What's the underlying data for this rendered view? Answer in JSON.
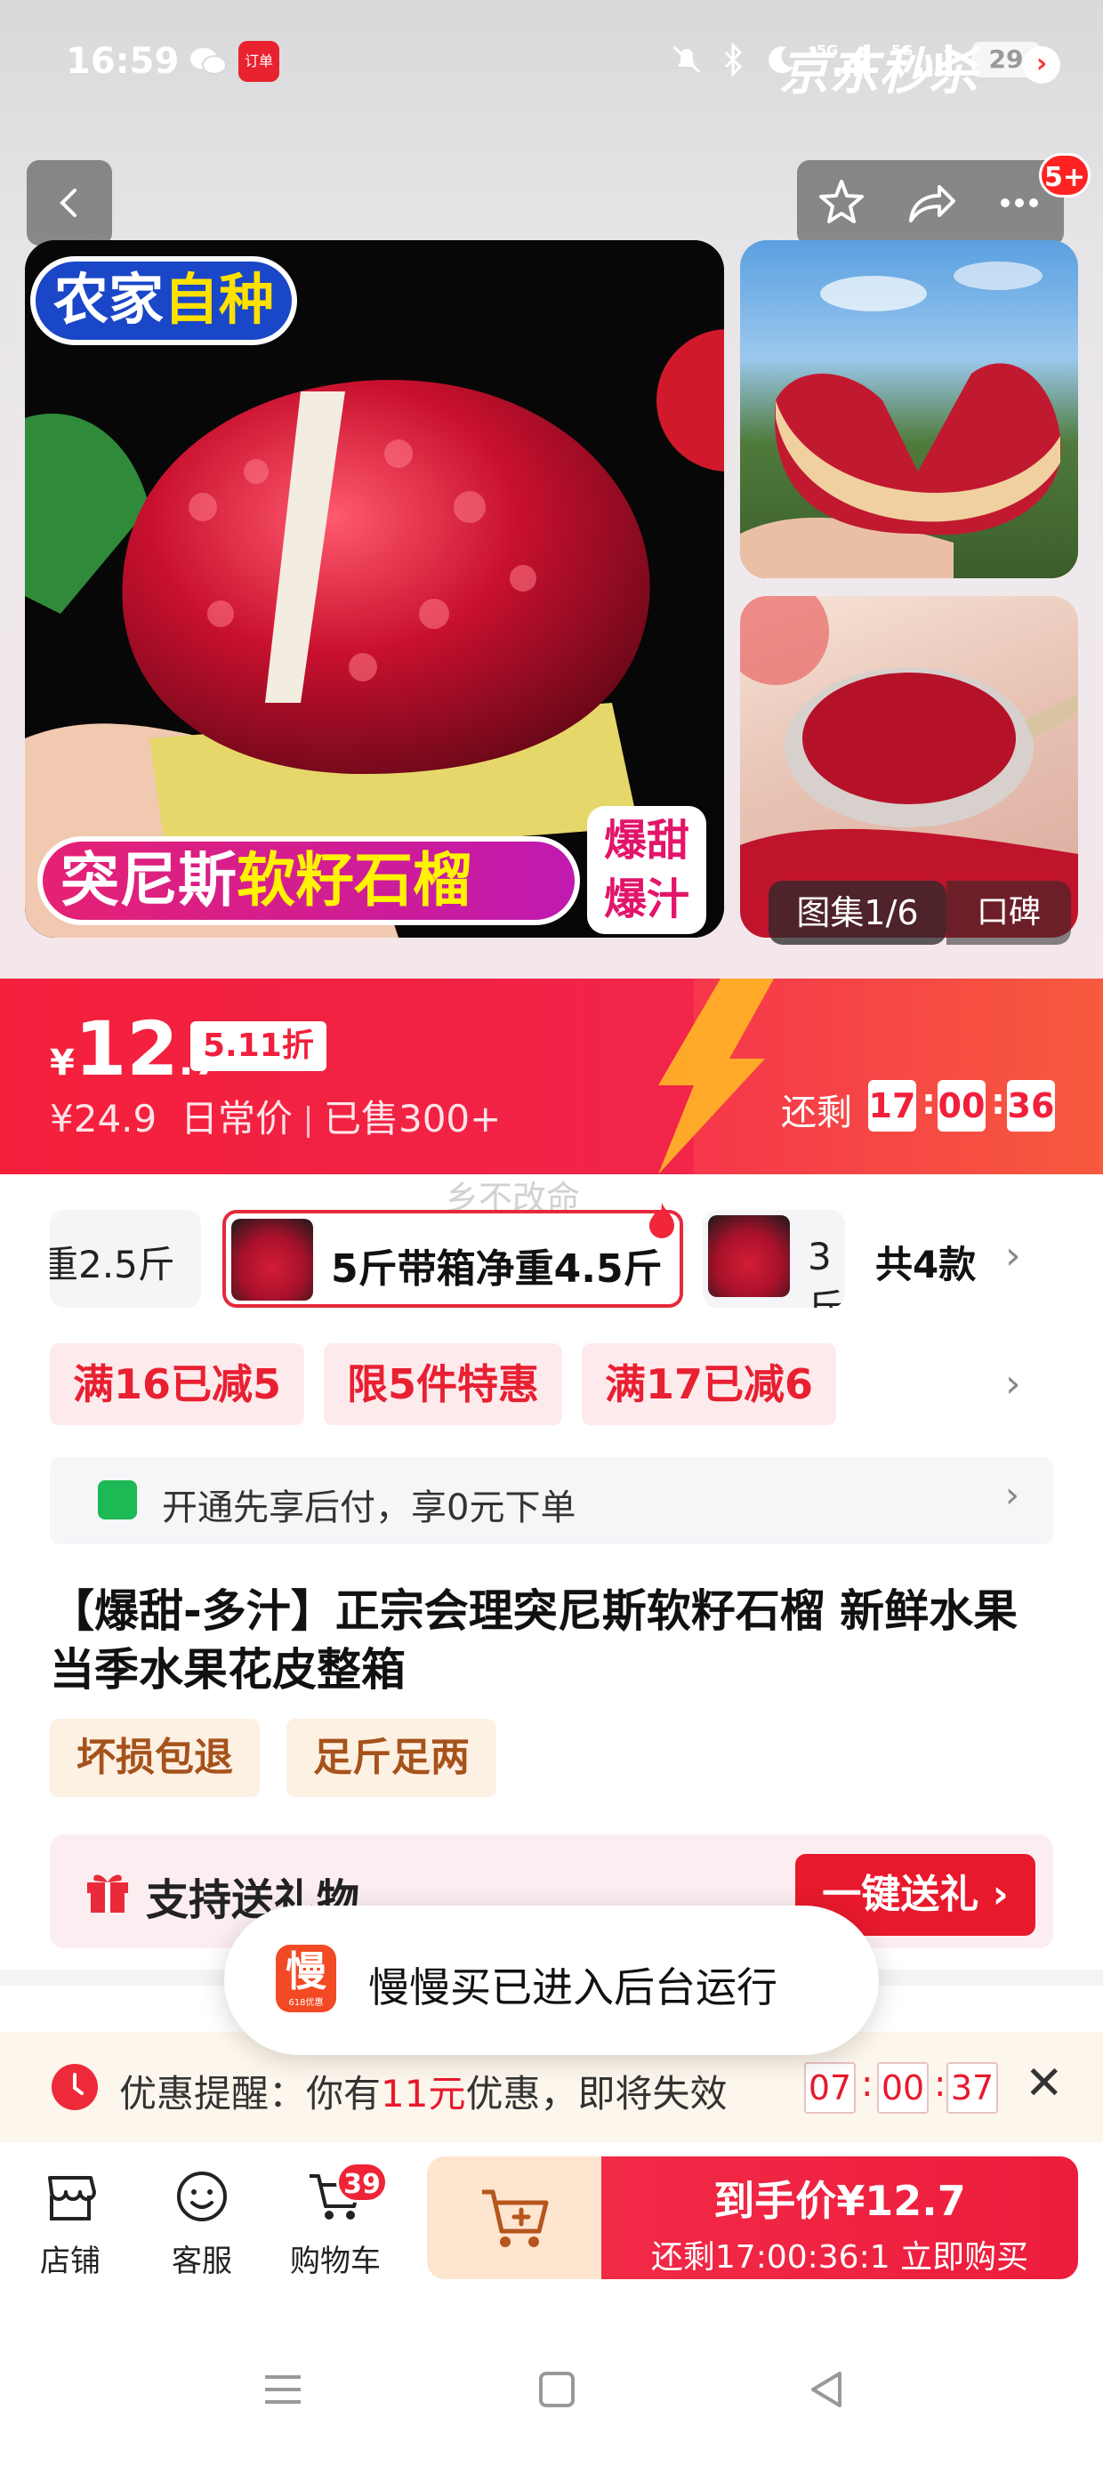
{
  "status_bar": {
    "time": "16:59",
    "app_badge": "订单",
    "network1": "5G",
    "network2": "5G",
    "battery": "29"
  },
  "header": {
    "cart_count_badge": "5+"
  },
  "gallery": {
    "tag_farm_part1": "农家",
    "tag_farm_part2": "自种",
    "title_part1": "突尼斯",
    "title_part2": "软籽石榴",
    "sweet_line1": "爆甜",
    "sweet_line2": "爆汁",
    "counter": "图集1/6",
    "review_label": "口碑"
  },
  "price": {
    "currency": "¥",
    "integer": "12",
    "decimal": ".7",
    "discount": "5.11折",
    "original": "¥24.9",
    "original_label": "日常价",
    "sold": "已售300+"
  },
  "flash_sale": {
    "title": "京东秒杀",
    "arrow": "›",
    "remain_label": "还剩",
    "hours": "17",
    "minutes": "00",
    "seconds": "36"
  },
  "watermark": "乡不改命",
  "variants": {
    "left_partial": "重2.5斤",
    "selected": "5斤带箱净重4.5斤",
    "right_partial": "3斤",
    "total": "共4款"
  },
  "promotions": [
    "满16已减5",
    "限5件特惠",
    "满17已减6"
  ],
  "pay_later": "开通先享后付，享0元下单",
  "product_title": "【爆甜-多汁】正宗会理突尼斯软籽石榴 新鲜水果当季水果花皮整箱",
  "tags": [
    "坏损包退",
    "足斤足两"
  ],
  "gift": {
    "text": "支持送礼物",
    "button": "一键送礼 ›"
  },
  "toast": {
    "icon_char": "慢",
    "icon_sub": "618优惠",
    "text": "慢慢买已进入后台运行"
  },
  "reminder": {
    "prefix": "优惠提醒：你有",
    "amount": "11元",
    "suffix": "优惠，即将失效",
    "hours": "07",
    "minutes": "00",
    "seconds": "37",
    "close": "✕"
  },
  "bottom_bar": {
    "shop": "店铺",
    "service": "客服",
    "cart": "购物车",
    "cart_badge": "39",
    "buy_line1": "到手价¥12.7",
    "buy_line2": "还剩17:00:36:1  立即购买"
  },
  "colors": {
    "accent_red": "#f41f3b",
    "promo_bg": "#fdeaec",
    "tag_brown": "#a6521b"
  }
}
